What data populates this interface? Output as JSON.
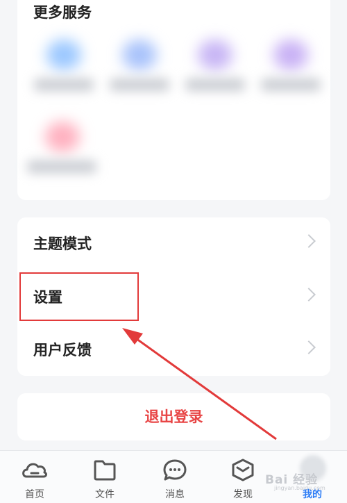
{
  "services": {
    "title": "更多服务",
    "items": [
      {
        "icon_color": "#9cc8ff"
      },
      {
        "icon_color": "#a9c3fb"
      },
      {
        "icon_color": "#c8b6f5"
      },
      {
        "icon_color": "#c9b2f5"
      },
      {
        "icon_color": "#ffb1c0"
      }
    ]
  },
  "menu": {
    "items": [
      {
        "label": "主题模式"
      },
      {
        "label": "设置"
      },
      {
        "label": "用户反馈"
      }
    ]
  },
  "logout": {
    "label": "退出登录"
  },
  "annotation": {
    "color": "#e23a3a"
  },
  "tabbar": {
    "tabs": [
      {
        "label": "首页",
        "icon": "cloud-icon"
      },
      {
        "label": "文件",
        "icon": "folder-icon"
      },
      {
        "label": "消息",
        "icon": "chat-bubble-icon"
      },
      {
        "label": "发现",
        "icon": "cube-icon"
      },
      {
        "label": "我的",
        "icon": "profile-icon",
        "active": true
      }
    ],
    "active_color": "#2b7cf6"
  },
  "watermark": {
    "text": "Bai 经验",
    "sub": "jingyan.baidu.com"
  }
}
